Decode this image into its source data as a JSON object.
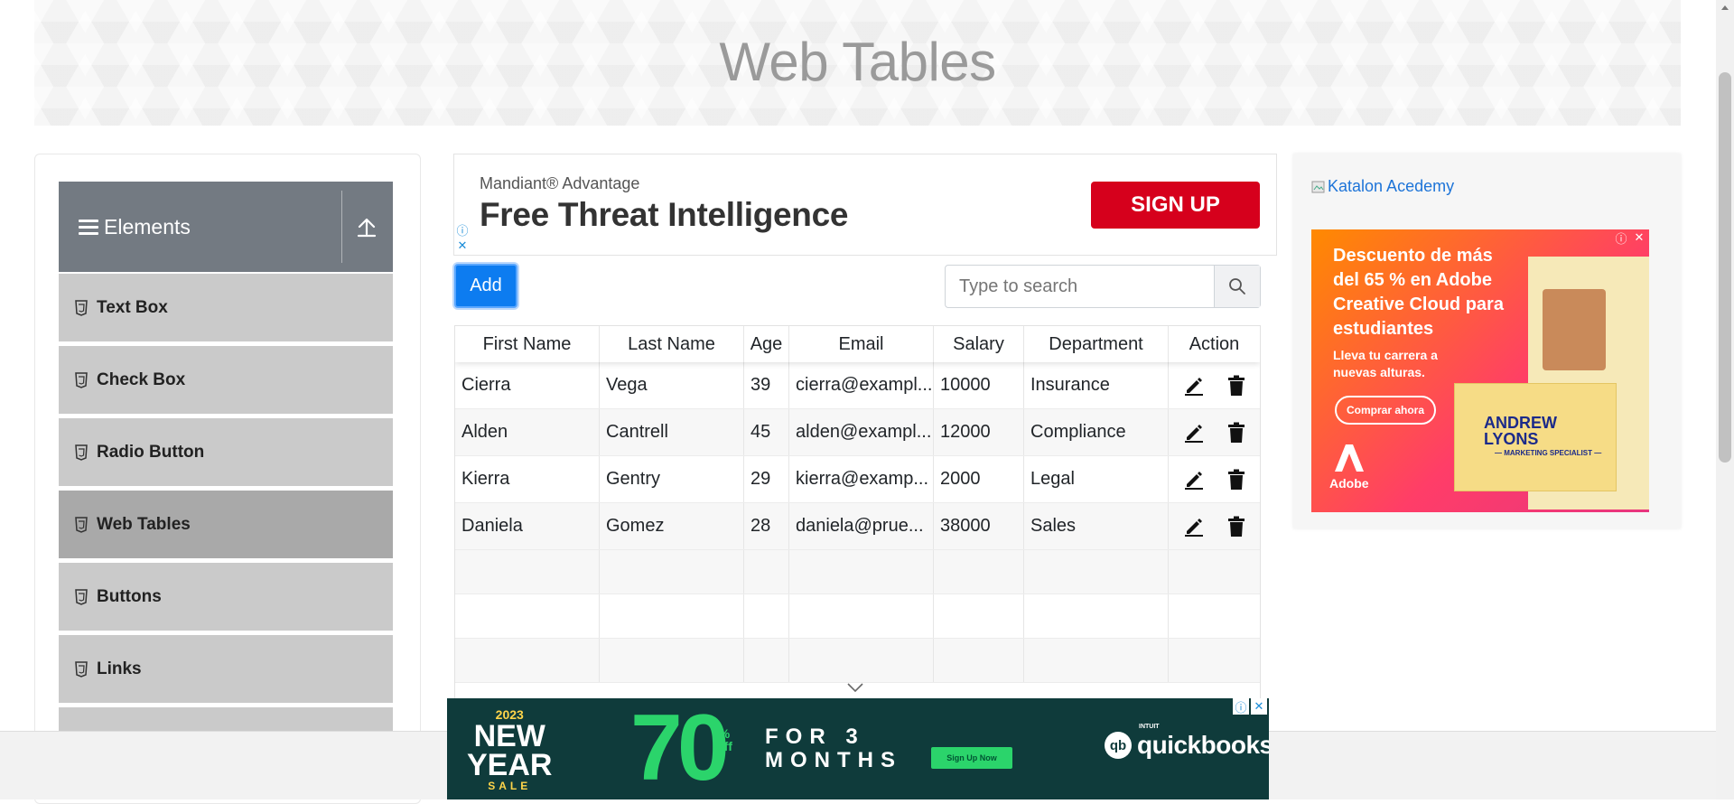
{
  "page": {
    "title": "Web Tables"
  },
  "sidebar": {
    "group_title": "Elements",
    "items": [
      {
        "label": "Text Box",
        "active": false
      },
      {
        "label": "Check Box",
        "active": false
      },
      {
        "label": "Radio Button",
        "active": false
      },
      {
        "label": "Web Tables",
        "active": true
      },
      {
        "label": "Buttons",
        "active": false
      },
      {
        "label": "Links",
        "active": false
      }
    ]
  },
  "top_ad": {
    "brand": "Mandiant® Advantage",
    "headline": "Free Threat Intelligence",
    "cta": "SIGN UP",
    "cta_color": "#d6001c"
  },
  "toolbar": {
    "add_label": "Add",
    "search_placeholder": "Type to search",
    "add_color": "#0d7cf0"
  },
  "table": {
    "columns": [
      "First Name",
      "Last Name",
      "Age",
      "Email",
      "Salary",
      "Department",
      "Action"
    ],
    "rows": [
      [
        "Cierra",
        "Vega",
        "39",
        "cierra@exampl...",
        "10000",
        "Insurance"
      ],
      [
        "Alden",
        "Cantrell",
        "45",
        "alden@exampl...",
        "12000",
        "Compliance"
      ],
      [
        "Kierra",
        "Gentry",
        "29",
        "kierra@examp...",
        "2000",
        "Legal"
      ],
      [
        "Daniela",
        "Gomez",
        "28",
        "daniela@prue...",
        "38000",
        "Sales"
      ]
    ],
    "empty_rows": 3,
    "row_actions": [
      "pencil-icon",
      "trash-icon"
    ]
  },
  "right_ad": {
    "image_alt": "Katalon Acedemy",
    "headline": "Descuento de más del 65 % en Adobe Creative Cloud para estudiantes",
    "subline": "Lleva tu carrera a nuevas alturas.",
    "cta": "Comprar ahora",
    "logo": "Adobe",
    "card_name": "ANDREW LYONS",
    "card_role": "— MARKETING SPECIALIST —"
  },
  "bottom_ad": {
    "year": "2023",
    "line1": "NEW",
    "line2": "YEAR",
    "sale": "SALE",
    "percent": "70",
    "off": "% off",
    "for_line1": "FOR 3",
    "for_line2": "MONTHS",
    "cta": "Sign Up Now",
    "brand_small": "INTUIT",
    "brand": "quickbooks"
  }
}
